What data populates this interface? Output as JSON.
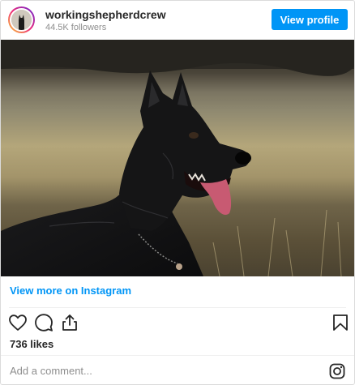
{
  "post": {
    "username": "workingshepherdcrew",
    "followers": "44.5K followers",
    "view_profile_label": "View profile",
    "view_more_label": "View more on Instagram",
    "likes": "736 likes",
    "comment_placeholder": "Add a comment..."
  },
  "icons": {
    "like": "heart-icon",
    "comment": "comment-icon",
    "share": "share-icon",
    "save": "bookmark-icon",
    "instagram": "instagram-icon"
  },
  "colors": {
    "accent": "#0095f6",
    "text": "#262626",
    "muted": "#8e8e8e",
    "border": "#dbdbdb"
  }
}
